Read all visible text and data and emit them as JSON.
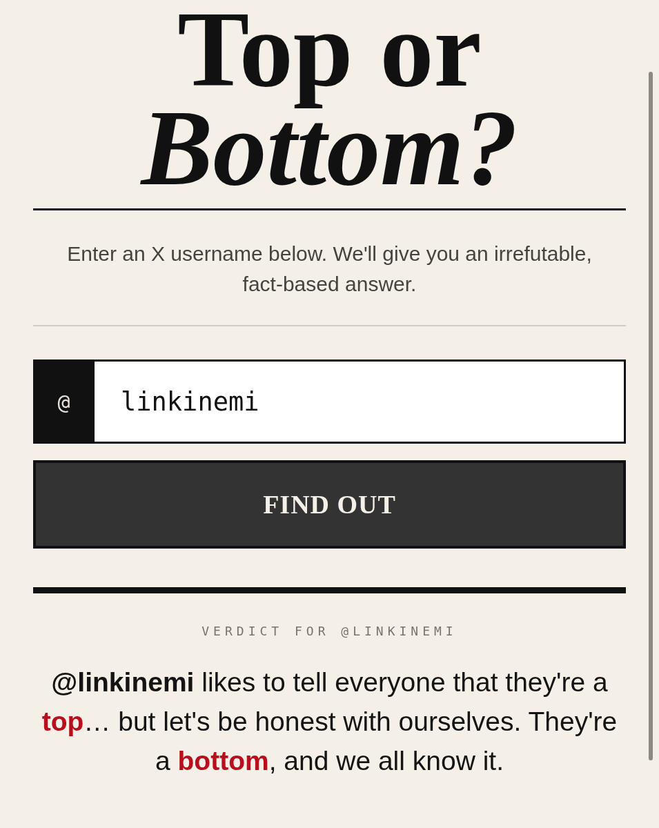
{
  "title": {
    "lines": [
      {
        "text": "Top or",
        "italic": false
      },
      {
        "text": "Bottom?",
        "italic": true
      }
    ]
  },
  "subtitle": "Enter an X username below. We'll give you an irrefutable, fact-based answer.",
  "username_field": {
    "prefix": "@",
    "value": "linkinemi"
  },
  "submit_button": {
    "label": "FIND OUT"
  },
  "verdict": {
    "label": "VERDICT FOR @LINKINEMI",
    "segments": [
      {
        "kind": "handle",
        "text": "@linkinemi"
      },
      {
        "kind": "plain",
        "text": " likes to tell everyone that they're a "
      },
      {
        "kind": "highlight",
        "text": "top"
      },
      {
        "kind": "plain",
        "text": "… but let's be honest with ourselves. They're a "
      },
      {
        "kind": "highlight",
        "text": "bottom"
      },
      {
        "kind": "plain",
        "text": ", and we all know it."
      }
    ]
  }
}
